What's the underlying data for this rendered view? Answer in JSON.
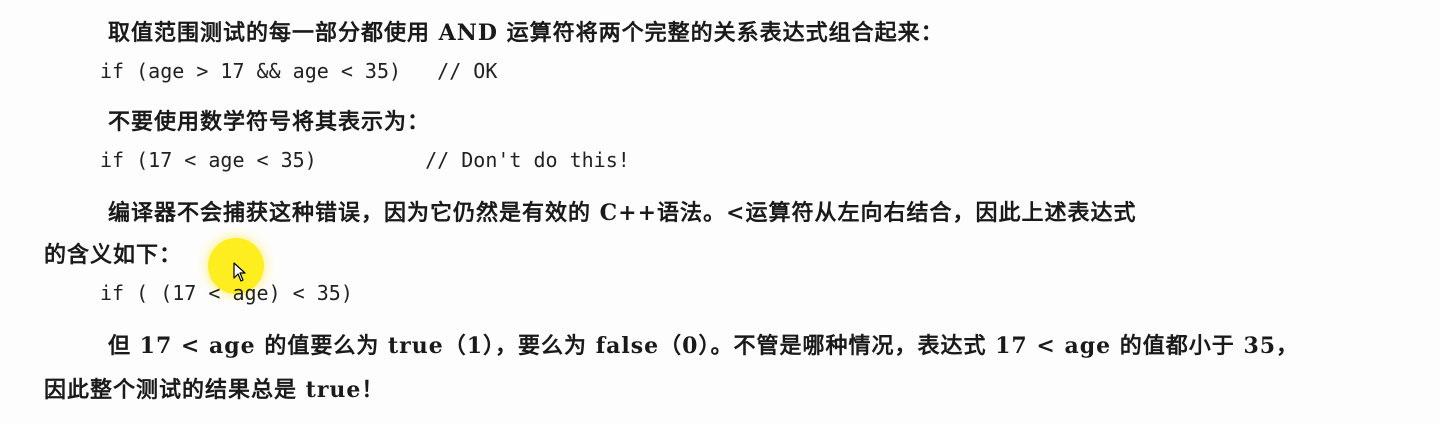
{
  "document": {
    "intro_text": "取值范围测试的每一部分都使用 AND 运算符将两个完整的关系表达式组合起来：",
    "code_ok": "if (age > 17 && age < 35)   // OK",
    "warn_text": "不要使用数学符号将其表示为：",
    "code_bad": "if (17 < age < 35)         // Don't do this!",
    "explain_line1": "编译器不会捕获这种错误，因为它仍然是有效的 C++语法。<运算符从左向右结合，因此上述表达式",
    "explain_line2": "的含义如下：",
    "code_equiv": "if ( (17 < age) < 35)",
    "result_line1": "但 17 < age 的值要么为 true（1），要么为 false（0）。不管是哪种情况，表达式 17 < age 的值都小于 35，",
    "result_line2": "因此整个测试的结果总是 true！"
  },
  "colors": {
    "highlight": "#ffec00",
    "text": "#1a1a1a",
    "background": "#fdfdfd"
  },
  "icons": {
    "cursor": "arrow-pointer-icon",
    "highlight": "yellow-circle-highlight"
  }
}
